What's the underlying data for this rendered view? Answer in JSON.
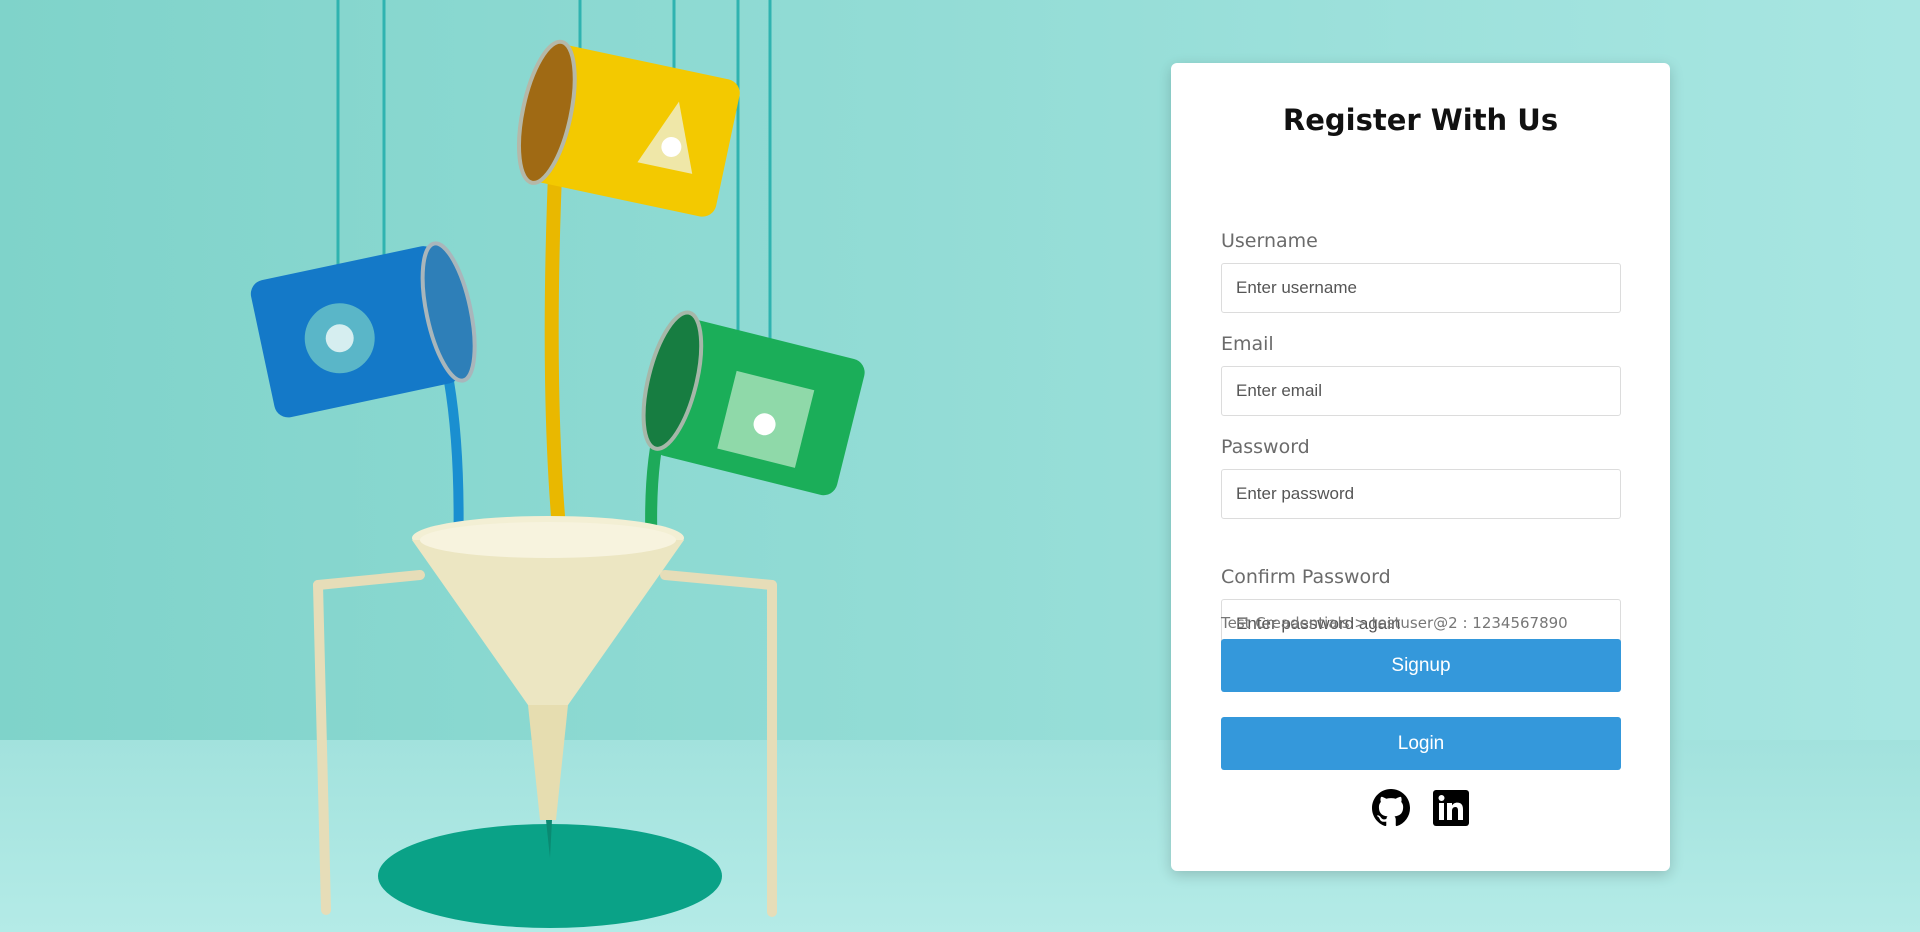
{
  "form": {
    "title": "Register With Us",
    "username": {
      "label": "Username",
      "placeholder": "Enter username",
      "value": ""
    },
    "email": {
      "label": "Email",
      "placeholder": "Enter email",
      "value": ""
    },
    "password": {
      "label": "Password",
      "placeholder": "Enter password",
      "value": ""
    },
    "confirm_password": {
      "label": "Confirm Password",
      "placeholder": "Enter password again",
      "value": ""
    },
    "hint": "Test Creadentials > testuser@2 : 1234567890",
    "signup_label": "Signup",
    "login_label": "Login"
  },
  "socials": [
    {
      "icon": "github-icon"
    },
    {
      "icon": "linkedin-icon"
    }
  ],
  "colors": {
    "background": "#8fd9d2",
    "button": "#3498db",
    "card": "#ffffff"
  }
}
